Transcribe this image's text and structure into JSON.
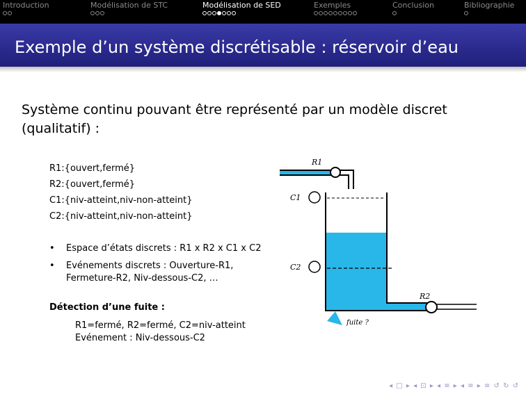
{
  "nav": {
    "sections": [
      {
        "label": "Introduction",
        "dots": [
          0,
          0
        ],
        "active": false
      },
      {
        "label": "Modélisation de STC",
        "dots": [
          0,
          0,
          0
        ],
        "active": false
      },
      {
        "label": "Modélisation de SED",
        "dots": [
          0,
          0,
          0,
          1,
          0,
          0,
          0
        ],
        "active": true
      },
      {
        "label": "Exemples",
        "dots": [
          0,
          0,
          0,
          0,
          0,
          0,
          0,
          0,
          0
        ],
        "active": false
      },
      {
        "label": "Conclusion",
        "dots": [
          0
        ],
        "active": false
      },
      {
        "label": "Bibliographie",
        "dots": [
          0
        ],
        "active": false
      }
    ]
  },
  "frame": {
    "title": "Exemple d’un système discrétisable : réservoir d’eau"
  },
  "body": {
    "intro": "Système continu pouvant être représenté par un modèle discret (qualitatif) :",
    "domains": [
      "R1:{ouvert,fermé}",
      "R2:{ouvert,fermé}",
      "C1:{niv-atteint,niv-non-atteint}",
      "C2:{niv-atteint,niv-non-atteint}"
    ],
    "bullets": [
      {
        "mark": "•",
        "lines": [
          "Espace d’états discrets : R1 x R2 x C1 x C2"
        ]
      },
      {
        "mark": "•",
        "lines": [
          "Evénements discrets : Ouverture-R1,",
          "Fermeture-R2, Niv-dessous-C2, …"
        ]
      }
    ],
    "detection": {
      "title": "Détection d’une fuite :",
      "lines": [
        "R1=fermé, R2=fermé, C2=niv-atteint",
        "Evénement : Niv-dessous-C2"
      ]
    }
  },
  "diagram": {
    "labels": {
      "r1": "R1",
      "c1": "C1",
      "c2": "C2",
      "r2": "R2",
      "leak": "fuite ?"
    },
    "water_color": "#29b6e8",
    "water_level_fraction": 0.66
  },
  "beamer_nav": "◂ □ ▸ ◂ ⊡ ▸ ◂ ≡ ▸ ◂ ≡ ▸   ≡   ↺ ↻ ↺"
}
